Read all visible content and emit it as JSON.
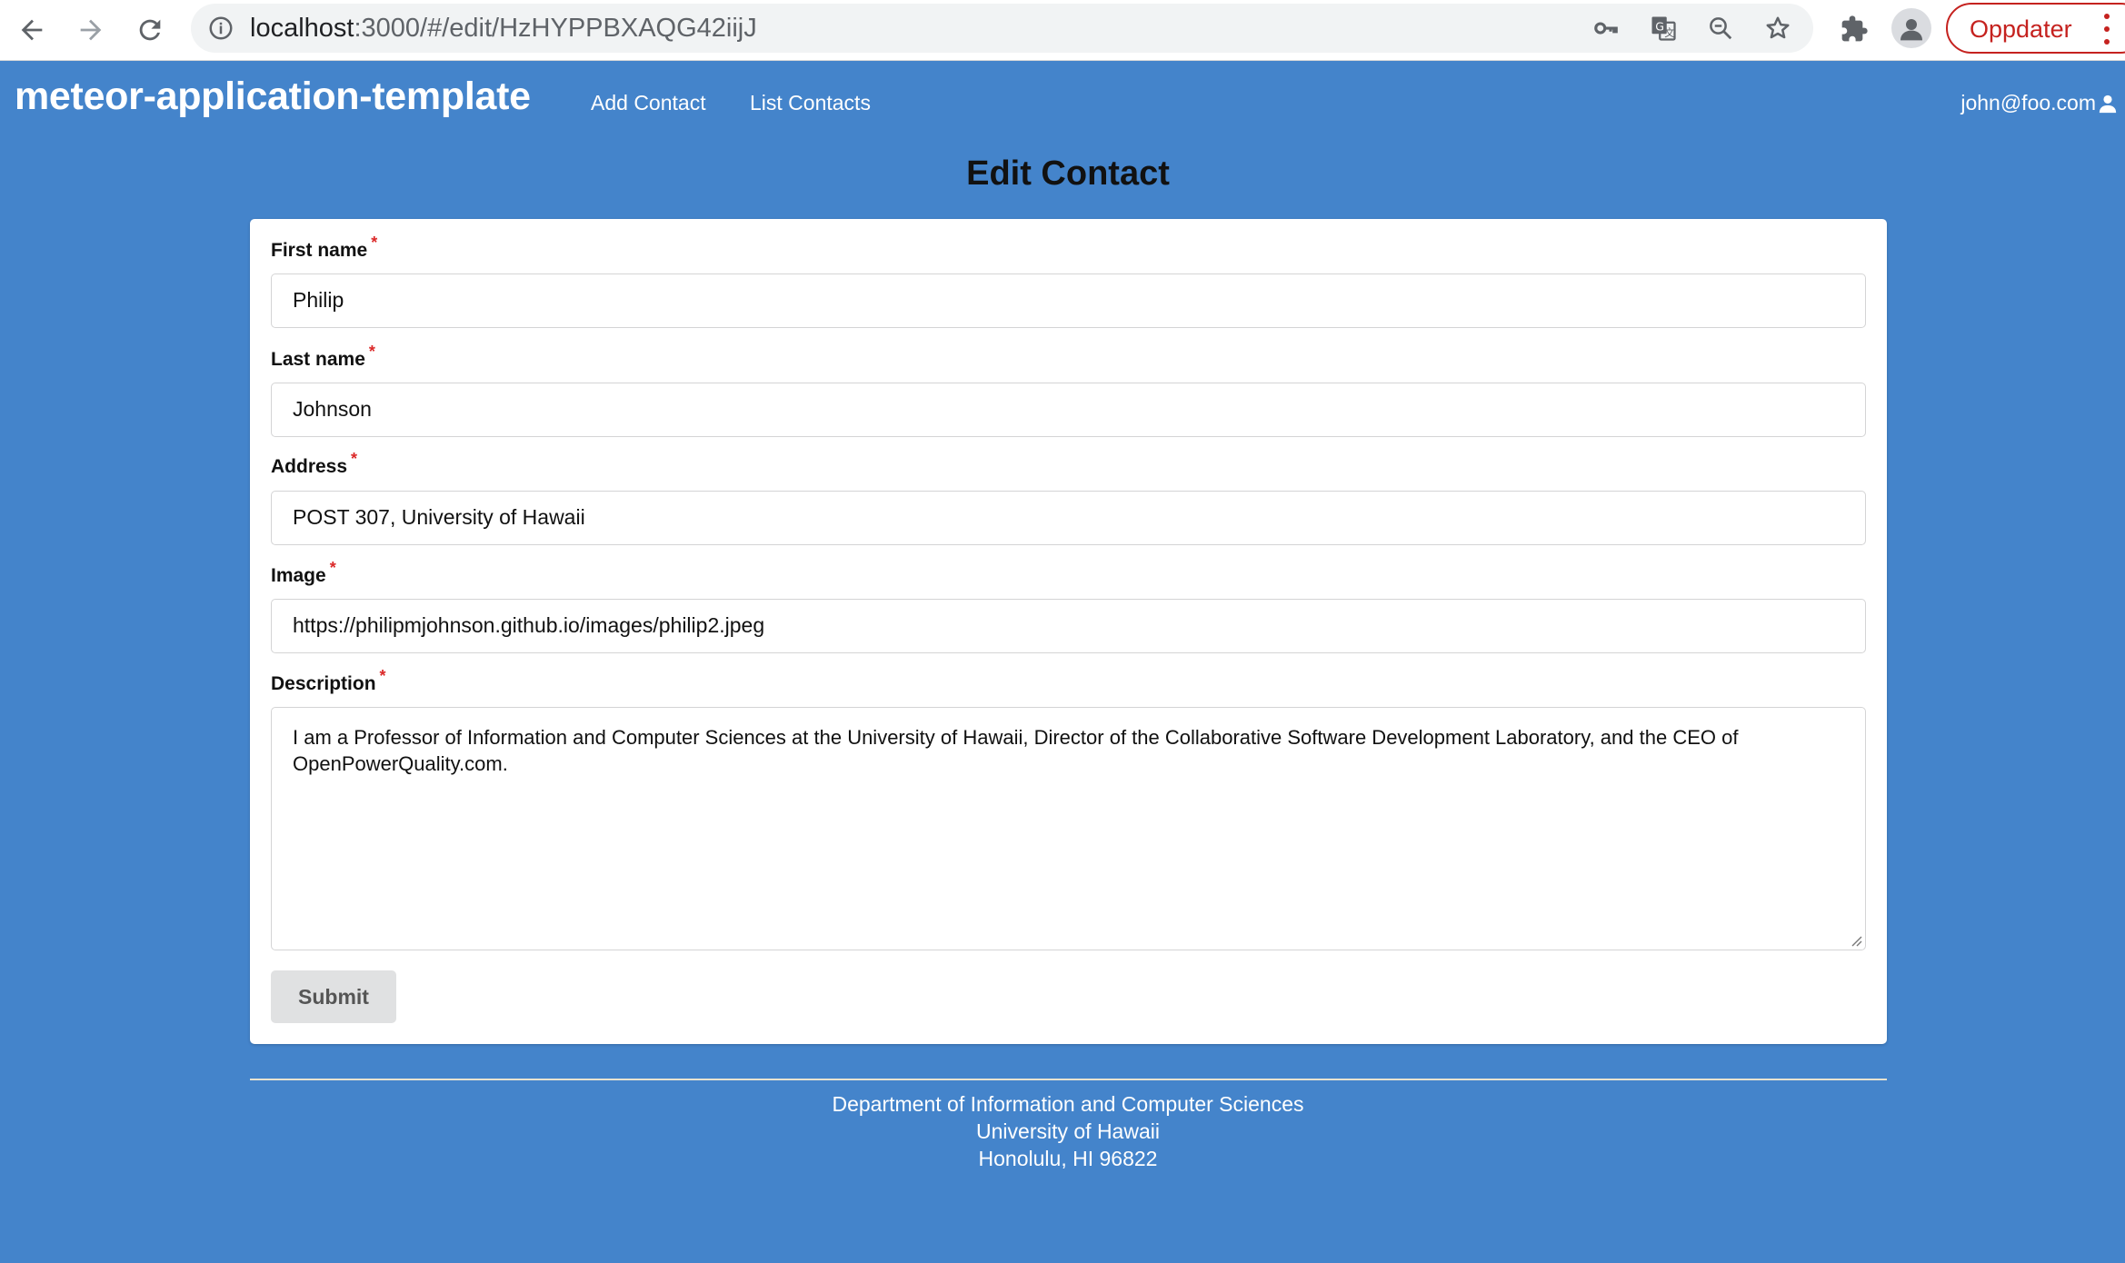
{
  "browser": {
    "url_host": "localhost",
    "url_path": ":3000/#/edit/HzHYPPBXAQG42iijJ",
    "update_button_label": "Oppdater",
    "icons": [
      "back-arrow-icon",
      "forward-arrow-icon",
      "reload-icon",
      "site-info-icon",
      "key-icon",
      "translate-icon",
      "zoom-out-icon",
      "star-icon",
      "puzzle-extension-icon",
      "profile-avatar-icon",
      "kebab-menu-icon"
    ]
  },
  "navbar": {
    "brand": "meteor-application-template",
    "links": [
      "Add Contact",
      "List Contacts"
    ],
    "user_email": "john@foo.com",
    "user_icon": "user-icon"
  },
  "page": {
    "title": "Edit Contact"
  },
  "form": {
    "required_marker": "*",
    "fields": [
      {
        "label": "First name",
        "value": "Philip"
      },
      {
        "label": "Last name",
        "value": "Johnson"
      },
      {
        "label": "Address",
        "value": "POST 307, University of Hawaii"
      },
      {
        "label": "Image",
        "value": "https://philipmjohnson.github.io/images/philip2.jpeg"
      }
    ],
    "description": {
      "label": "Description",
      "value": "I am a Professor of Information and Computer Sciences at the University of Hawaii, Director of the Collaborative Software Development Laboratory, and the CEO of OpenPowerQuality.com."
    },
    "submit_label": "Submit"
  },
  "footer": {
    "lines": [
      "Department of Information and Computer Sciences",
      "University of Hawaii",
      "Honolulu, HI 96822"
    ]
  },
  "colors": {
    "background": "#4484cb",
    "required": "#db2828",
    "update_button": "#c5221f"
  }
}
